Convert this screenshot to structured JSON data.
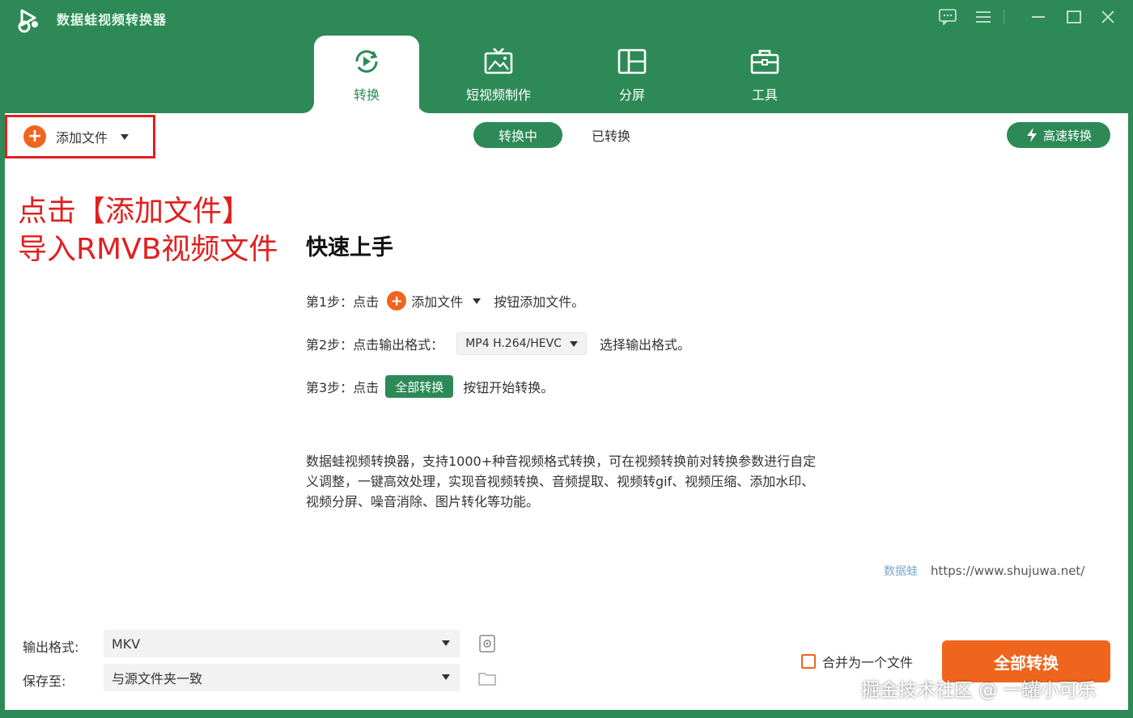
{
  "app": {
    "title": "数据蛙视频转换器"
  },
  "tabs": [
    {
      "label": "转换"
    },
    {
      "label": "短视频制作"
    },
    {
      "label": "分屏"
    },
    {
      "label": "工具"
    }
  ],
  "toolbar": {
    "add_file": "添加文件",
    "seg_converting": "转换中",
    "seg_converted": "已转换",
    "high_speed": "高速转换"
  },
  "annotation": {
    "line1": "点击【添加文件】",
    "line2": "导入RMVB视频文件"
  },
  "quickstart": {
    "title": "快速上手",
    "step1_prefix": "第1步：点击",
    "step1_btn": "添加文件",
    "step1_suffix": "按钮添加文件。",
    "step2_prefix": "第2步：点击输出格式：",
    "step2_select": "MP4 H.264/HEVC",
    "step2_suffix": "选择输出格式。",
    "step3_prefix": "第3步：点击",
    "step3_btn": "全部转换",
    "step3_suffix": "按钮开始转换。"
  },
  "description": "数据蛙视频转换器，支持1000+种音视频格式转换，可在视频转换前对转换参数进行自定义调整，一键高效处理，实现音视频转换、音频提取、视频转gif、视频压缩、添加水印、视频分屏、噪音消除、图片转化等功能。",
  "brand": {
    "mark": "数据蛙",
    "url": "https://www.shujuwa.net/"
  },
  "bottom": {
    "output_format_label": "输出格式:",
    "output_format_value": "MKV",
    "save_to_label": "保存至:",
    "save_to_value": "与源文件夹一致",
    "merge_label": "合并为一个文件",
    "convert_all": "全部转换"
  },
  "watermark": "掘金技术社区 @ 一罐小可乐",
  "colors": {
    "brand_green": "#2d8a57",
    "accent_orange": "#f0651e",
    "annotation_red": "#e02020"
  }
}
